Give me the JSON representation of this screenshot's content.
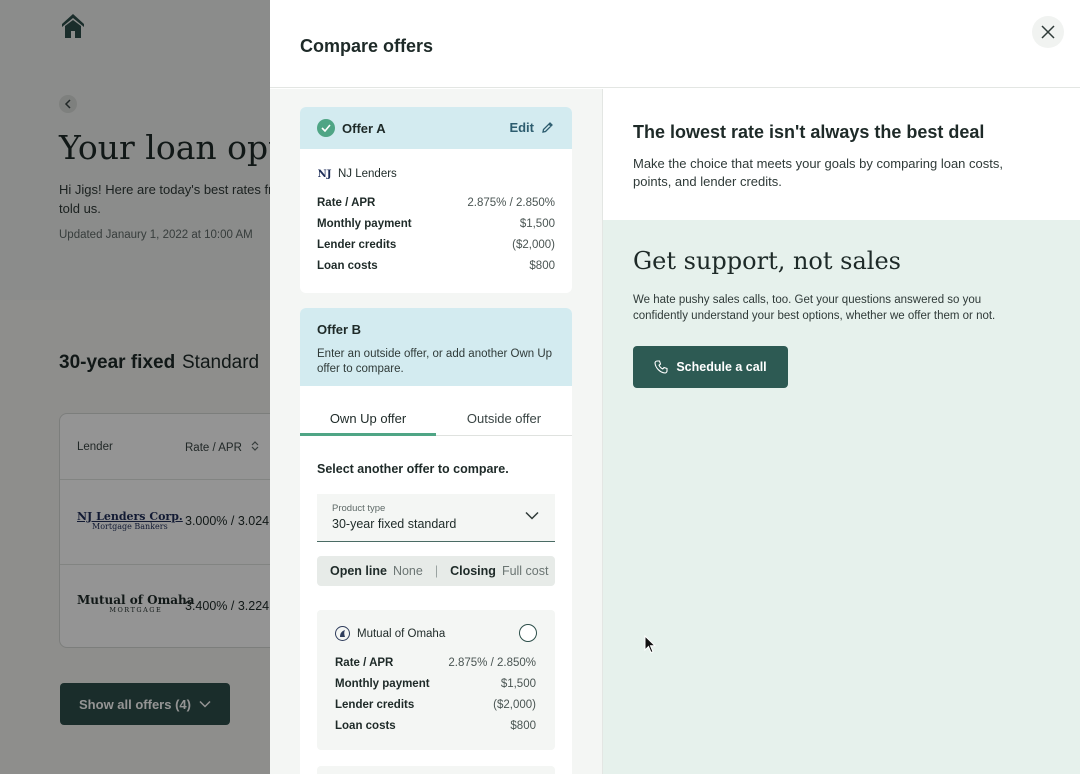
{
  "background": {
    "title": "Your loan optio",
    "intro": "Hi Jigs! Here are today's best rates fro you told us.",
    "updated": "Updated Janaury 1, 2022 at 10:00 AM",
    "tab_fixed": "30-year fixed",
    "tab_standard": "Standard",
    "table_headers": {
      "lender": "Lender",
      "rate": "Rate / APR"
    },
    "rows": [
      {
        "lender_logo_line1": "NJ Lenders Corp.",
        "lender_logo_line2": "Mortgage Bankers",
        "rate": "3.000% / 3.024"
      },
      {
        "lender_logo_line1": "Mutual of Omaha",
        "lender_logo_line2": "MORTGAGE",
        "rate": "3.400% / 3.224"
      }
    ],
    "show_all": "Show all offers (4)"
  },
  "modal": {
    "title": "Compare offers",
    "offer_a": {
      "label": "Offer A",
      "edit": "Edit",
      "lender": "NJ Lenders",
      "lender_mark": "NJ",
      "stats": [
        {
          "label": "Rate / APR",
          "value": "2.875% / 2.850%"
        },
        {
          "label": "Monthly payment",
          "value": "$1,500"
        },
        {
          "label": "Lender credits",
          "value": "($2,000)"
        },
        {
          "label": "Loan costs",
          "value": "$800"
        }
      ]
    },
    "offer_b": {
      "title": "Offer B",
      "description": "Enter an outside offer, or add another Own Up offer to compare.",
      "tabs": [
        "Own Up offer",
        "Outside offer"
      ],
      "prompt": "Select another offer to compare.",
      "product_type": {
        "label": "Product type",
        "value": "30-year fixed standard"
      },
      "filters": {
        "open_line_key": "Open line",
        "open_line_val": "None",
        "separator": "|",
        "closing_key": "Closing",
        "closing_val": "Full cost"
      },
      "lender_card": {
        "lender": "Mutual of Omaha",
        "stats": [
          {
            "label": "Rate / APR",
            "value": "2.875% / 2.850%"
          },
          {
            "label": "Monthly payment",
            "value": "$1,500"
          },
          {
            "label": "Lender credits",
            "value": "($2,000)"
          },
          {
            "label": "Loan costs",
            "value": "$800"
          }
        ]
      }
    },
    "right": {
      "heading": "The lowest rate isn't always the best deal",
      "text": "Make the choice that meets your goals by comparing loan costs, points, and lender credits.",
      "support_title": "Get support, not sales",
      "support_text": "We hate pushy sales calls, too. Get your questions answered so you confidently understand your best options, whether we offer them or not.",
      "schedule_button": "Schedule a call"
    }
  },
  "colors": {
    "brand_dark": "#2d5a53",
    "accent_green": "#4fa585",
    "offer_head": "#d3ebf0",
    "support_bg": "#e6f1ec"
  }
}
